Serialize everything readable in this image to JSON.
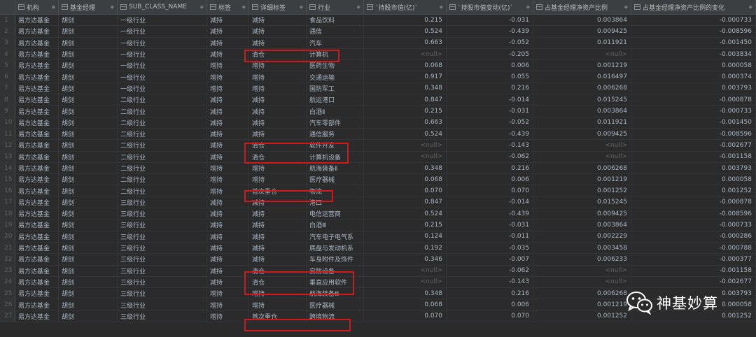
{
  "columns": [
    {
      "label": "",
      "num": false
    },
    {
      "label": "机构",
      "num": false
    },
    {
      "label": "基金经理",
      "num": false
    },
    {
      "label": "SUB_CLASS_NAME",
      "num": false
    },
    {
      "label": "标签",
      "num": false
    },
    {
      "label": "详细标签",
      "num": false
    },
    {
      "label": "行业",
      "num": false
    },
    {
      "label": "`持股市值(亿)`",
      "num": true
    },
    {
      "label": "`持股市值变动(亿)`",
      "num": true
    },
    {
      "label": "占基金经理净资产比例",
      "num": true
    },
    {
      "label": "占基金经理净资产比例的变化",
      "num": true
    }
  ],
  "sort_glyph": "◆",
  "rows": [
    [
      "1",
      "易方达基金",
      "胡剑",
      "一级行业",
      "减持",
      "减持",
      "食品饮料",
      "0.215",
      "-0.031",
      "0.003864",
      "-0.000733"
    ],
    [
      "2",
      "易方达基金",
      "胡剑",
      "一级行业",
      "减持",
      "减持",
      "通信",
      "0.524",
      "-0.439",
      "0.009425",
      "-0.008596"
    ],
    [
      "3",
      "易方达基金",
      "胡剑",
      "一级行业",
      "减持",
      "减持",
      "汽车",
      "0.663",
      "-0.052",
      "0.011921",
      "-0.001450"
    ],
    [
      "4",
      "易方达基金",
      "胡剑",
      "一级行业",
      "减持",
      "清仓",
      "计算机",
      "<null>",
      "-0.205",
      "<null>",
      "-0.003834"
    ],
    [
      "5",
      "易方达基金",
      "胡剑",
      "一级行业",
      "增持",
      "增持",
      "医药生物",
      "0.068",
      "0.006",
      "0.001219",
      "0.000058"
    ],
    [
      "6",
      "易方达基金",
      "胡剑",
      "一级行业",
      "增持",
      "增持",
      "交通运输",
      "0.917",
      "0.055",
      "0.016497",
      "0.000374"
    ],
    [
      "7",
      "易方达基金",
      "胡剑",
      "一级行业",
      "增持",
      "增持",
      "国防军工",
      "0.348",
      "0.216",
      "0.006268",
      "0.003793"
    ],
    [
      "8",
      "易方达基金",
      "胡剑",
      "二级行业",
      "减持",
      "减持",
      "航运港口",
      "0.847",
      "-0.014",
      "0.015245",
      "-0.000878"
    ],
    [
      "9",
      "易方达基金",
      "胡剑",
      "二级行业",
      "减持",
      "减持",
      "白酒Ⅱ",
      "0.215",
      "-0.031",
      "0.003864",
      "-0.000733"
    ],
    [
      "10",
      "易方达基金",
      "胡剑",
      "二级行业",
      "减持",
      "减持",
      "汽车零部件",
      "0.663",
      "-0.052",
      "0.011921",
      "-0.001450"
    ],
    [
      "11",
      "易方达基金",
      "胡剑",
      "二级行业",
      "减持",
      "减持",
      "通信服务",
      "0.524",
      "-0.439",
      "0.009425",
      "-0.008596"
    ],
    [
      "12",
      "易方达基金",
      "胡剑",
      "二级行业",
      "减持",
      "清仓",
      "软件开发",
      "<null>",
      "-0.143",
      "<null>",
      "-0.002677"
    ],
    [
      "13",
      "易方达基金",
      "胡剑",
      "二级行业",
      "减持",
      "清仓",
      "计算机设备",
      "<null>",
      "-0.062",
      "<null>",
      "-0.001158"
    ],
    [
      "14",
      "易方达基金",
      "胡剑",
      "二级行业",
      "增持",
      "增持",
      "航海装备Ⅱ",
      "0.348",
      "0.216",
      "0.006268",
      "0.003793"
    ],
    [
      "15",
      "易方达基金",
      "胡剑",
      "二级行业",
      "增持",
      "增持",
      "医疗器械",
      "0.068",
      "0.006",
      "0.001219",
      "0.000058"
    ],
    [
      "16",
      "易方达基金",
      "胡剑",
      "二级行业",
      "增持",
      "首次重仓",
      "物流",
      "0.070",
      "0.070",
      "0.001252",
      "0.001252"
    ],
    [
      "17",
      "易方达基金",
      "胡剑",
      "三级行业",
      "减持",
      "减持",
      "港口",
      "0.847",
      "-0.014",
      "0.015245",
      "-0.000878"
    ],
    [
      "18",
      "易方达基金",
      "胡剑",
      "三级行业",
      "减持",
      "减持",
      "电信运营商",
      "0.524",
      "-0.439",
      "0.009425",
      "-0.008596"
    ],
    [
      "19",
      "易方达基金",
      "胡剑",
      "三级行业",
      "减持",
      "减持",
      "白酒Ⅲ",
      "0.215",
      "-0.031",
      "0.003864",
      "-0.000733"
    ],
    [
      "20",
      "易方达基金",
      "胡剑",
      "三级行业",
      "减持",
      "减持",
      "汽车电子电气系",
      "0.124",
      "-0.011",
      "0.002229",
      "-0.000286"
    ],
    [
      "21",
      "易方达基金",
      "胡剑",
      "三级行业",
      "减持",
      "减持",
      "底盘与发动机系",
      "0.192",
      "-0.035",
      "0.003458",
      "-0.000788"
    ],
    [
      "22",
      "易方达基金",
      "胡剑",
      "三级行业",
      "减持",
      "减持",
      "车身附件及饰件",
      "0.346",
      "-0.007",
      "0.006233",
      "-0.000377"
    ],
    [
      "23",
      "易方达基金",
      "胡剑",
      "三级行业",
      "减持",
      "清仓",
      "安防设备",
      "<null>",
      "-0.062",
      "<null>",
      "-0.001158"
    ],
    [
      "24",
      "易方达基金",
      "胡剑",
      "三级行业",
      "减持",
      "清仓",
      "垂直应用软件",
      "<null>",
      "-0.143",
      "<null>",
      "-0.002677"
    ],
    [
      "25",
      "易方达基金",
      "胡剑",
      "三级行业",
      "增持",
      "增持",
      "航海装备Ⅲ",
      "0.348",
      "0.216",
      "0.006268",
      "0.003793"
    ],
    [
      "26",
      "易方达基金",
      "胡剑",
      "三级行业",
      "增持",
      "增持",
      "医疗器械",
      "0.068",
      "0.006",
      "0.001219",
      "0.000058"
    ],
    [
      "27",
      "易方达基金",
      "胡剑",
      "三级行业",
      "增持",
      "首次重仓",
      "跨境物流",
      "0.070",
      "0.070",
      "0.001252",
      "0.001252"
    ]
  ],
  "highlight_color": "#d0191f",
  "watermark": {
    "text": "神基妙算",
    "icon": "wechat-icon"
  }
}
